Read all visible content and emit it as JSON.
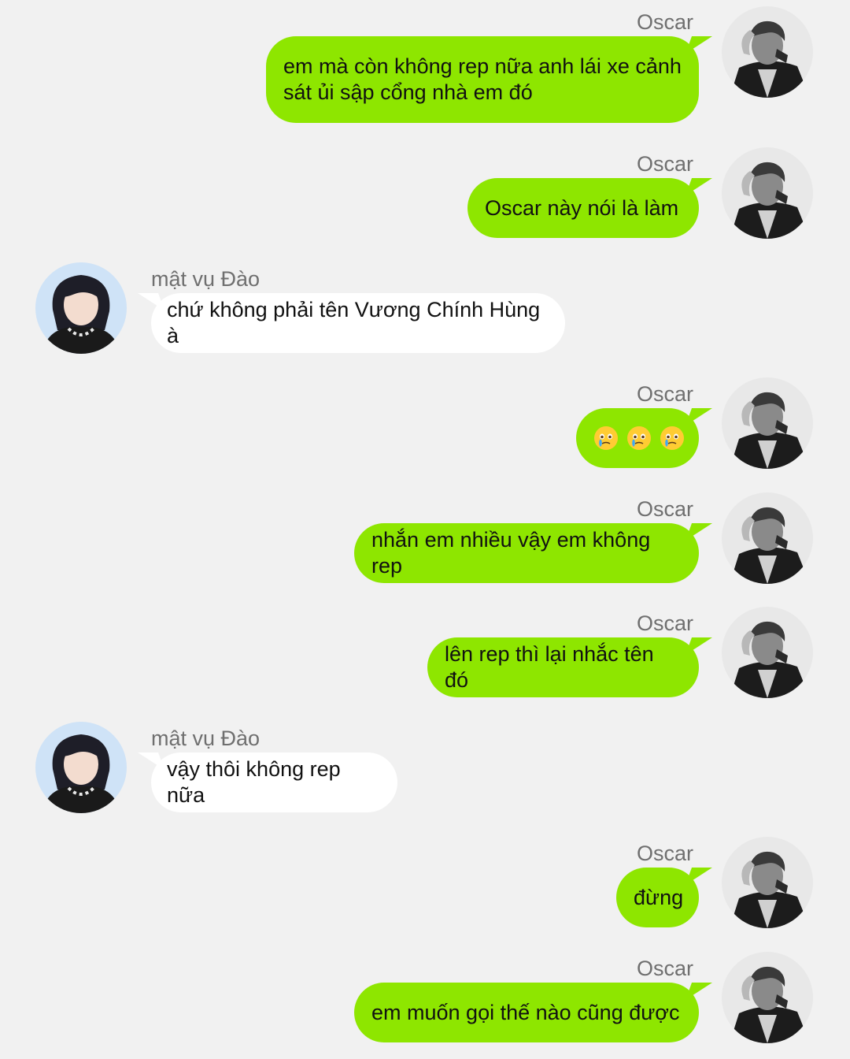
{
  "messages": [
    {
      "sender": "Oscar",
      "text": "em mà còn không rep nữa anh lái xe cảnh\nsát ủi sập cổng nhà em đó"
    },
    {
      "sender": "Oscar",
      "text": "Oscar này nói là làm"
    },
    {
      "sender": "mật vụ Đào",
      "text": "chứ không phải tên Vương Chính Hùng à"
    },
    {
      "sender": "Oscar",
      "emojis": [
        "face-holding-back-tears",
        "face-holding-back-tears",
        "face-holding-back-tears"
      ]
    },
    {
      "sender": "Oscar",
      "text": "nhắn em nhiều vậy em không rep"
    },
    {
      "sender": "Oscar",
      "text": "lên rep thì lại nhắc tên đó"
    },
    {
      "sender": "mật vụ Đào",
      "text": "vậy thôi không rep nữa"
    },
    {
      "sender": "Oscar",
      "text": "đừng"
    },
    {
      "sender": "Oscar",
      "text": "em muốn gọi thế nào cũng được"
    }
  ],
  "colors": {
    "background": "#f1f1f1",
    "outgoing_bubble": "#8ee600",
    "incoming_bubble": "#ffffff",
    "sender_name": "#6f6f6f"
  }
}
